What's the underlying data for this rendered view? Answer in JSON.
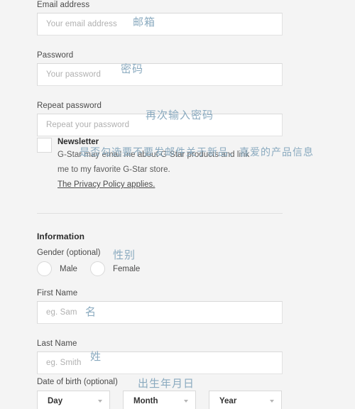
{
  "account": {
    "email": {
      "label": "Email address",
      "placeholder": "Your email address",
      "annotation": "邮箱"
    },
    "password": {
      "label": "Password",
      "placeholder": "Your password",
      "annotation": "密码"
    },
    "repeat_password": {
      "label": "Repeat password",
      "placeholder": "Repeat your password",
      "annotation": "再次输入密码"
    }
  },
  "newsletter": {
    "title": "Newsletter",
    "description_line1": "G-Star may email me about G-Star products and link",
    "description_line2": "me to my favorite G-Star store.",
    "privacy_link": "The Privacy Policy applies.",
    "checked": false,
    "annotation": "是否勾选要不要发邮件关于新品、喜爱的产品信息"
  },
  "information": {
    "section_title": "Information",
    "gender": {
      "label": "Gender (optional)",
      "annotation": "性别",
      "options": [
        "Male",
        "Female"
      ],
      "selected": ""
    },
    "first_name": {
      "label": "First Name",
      "placeholder": "eg. Sam",
      "annotation": "名"
    },
    "last_name": {
      "label": "Last Name",
      "placeholder": "eg. Smith",
      "annotation": "姓"
    },
    "date_of_birth": {
      "label": "Date of birth (optional)",
      "annotation": "出生年月日",
      "day": "Day",
      "month": "Month",
      "year": "Year"
    }
  },
  "colors": {
    "background": "#f4f4f4",
    "field_background": "#ffffff",
    "field_border": "#d9d9d9",
    "label_text": "#4a4a4a",
    "placeholder_text": "#b0b0b0",
    "annotation_blue": "#8aaabf"
  }
}
